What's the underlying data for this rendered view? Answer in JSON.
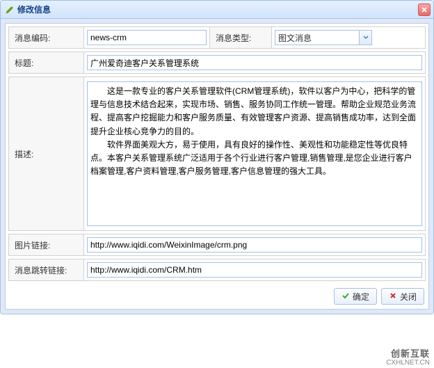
{
  "header": {
    "title": "修改信息"
  },
  "form": {
    "code_label": "消息编码:",
    "code_value": "news-crm",
    "type_label": "消息类型:",
    "type_value": "图文消息",
    "title_label": "标题:",
    "title_value": "广州爱奇迪客户关系管理系统",
    "desc_label": "描述:",
    "desc_value": "　　这是一款专业的客户关系管理软件(CRM管理系统)，软件以客户为中心，把科学的管理与信息技术结合起来，实现市场、销售、服务协同工作统一管理。帮助企业规范业务流程、提高客户挖掘能力和客户服务质量、有效管理客户资源、提高销售成功率，达到全面提升企业核心竞争力的目的。\n　　软件界面美观大方，易于使用，具有良好的操作性、美观性和功能稳定性等优良特点。本客户关系管理系统广泛适用于各个行业进行客户管理,销售管理,是您企业进行客户档案管理,客户资料管理,客户服务管理,客户信息管理的强大工具。",
    "image_label": "图片链接:",
    "image_value": "http://www.iqidi.com/WeixinImage/crm.png",
    "jump_label": "消息跳转链接:",
    "jump_value": "http://www.iqidi.com/CRM.htm"
  },
  "buttons": {
    "ok": "确定",
    "cancel": "关闭"
  },
  "watermark": {
    "top": "创新互联",
    "bottom": "CXHLNET.CN"
  }
}
